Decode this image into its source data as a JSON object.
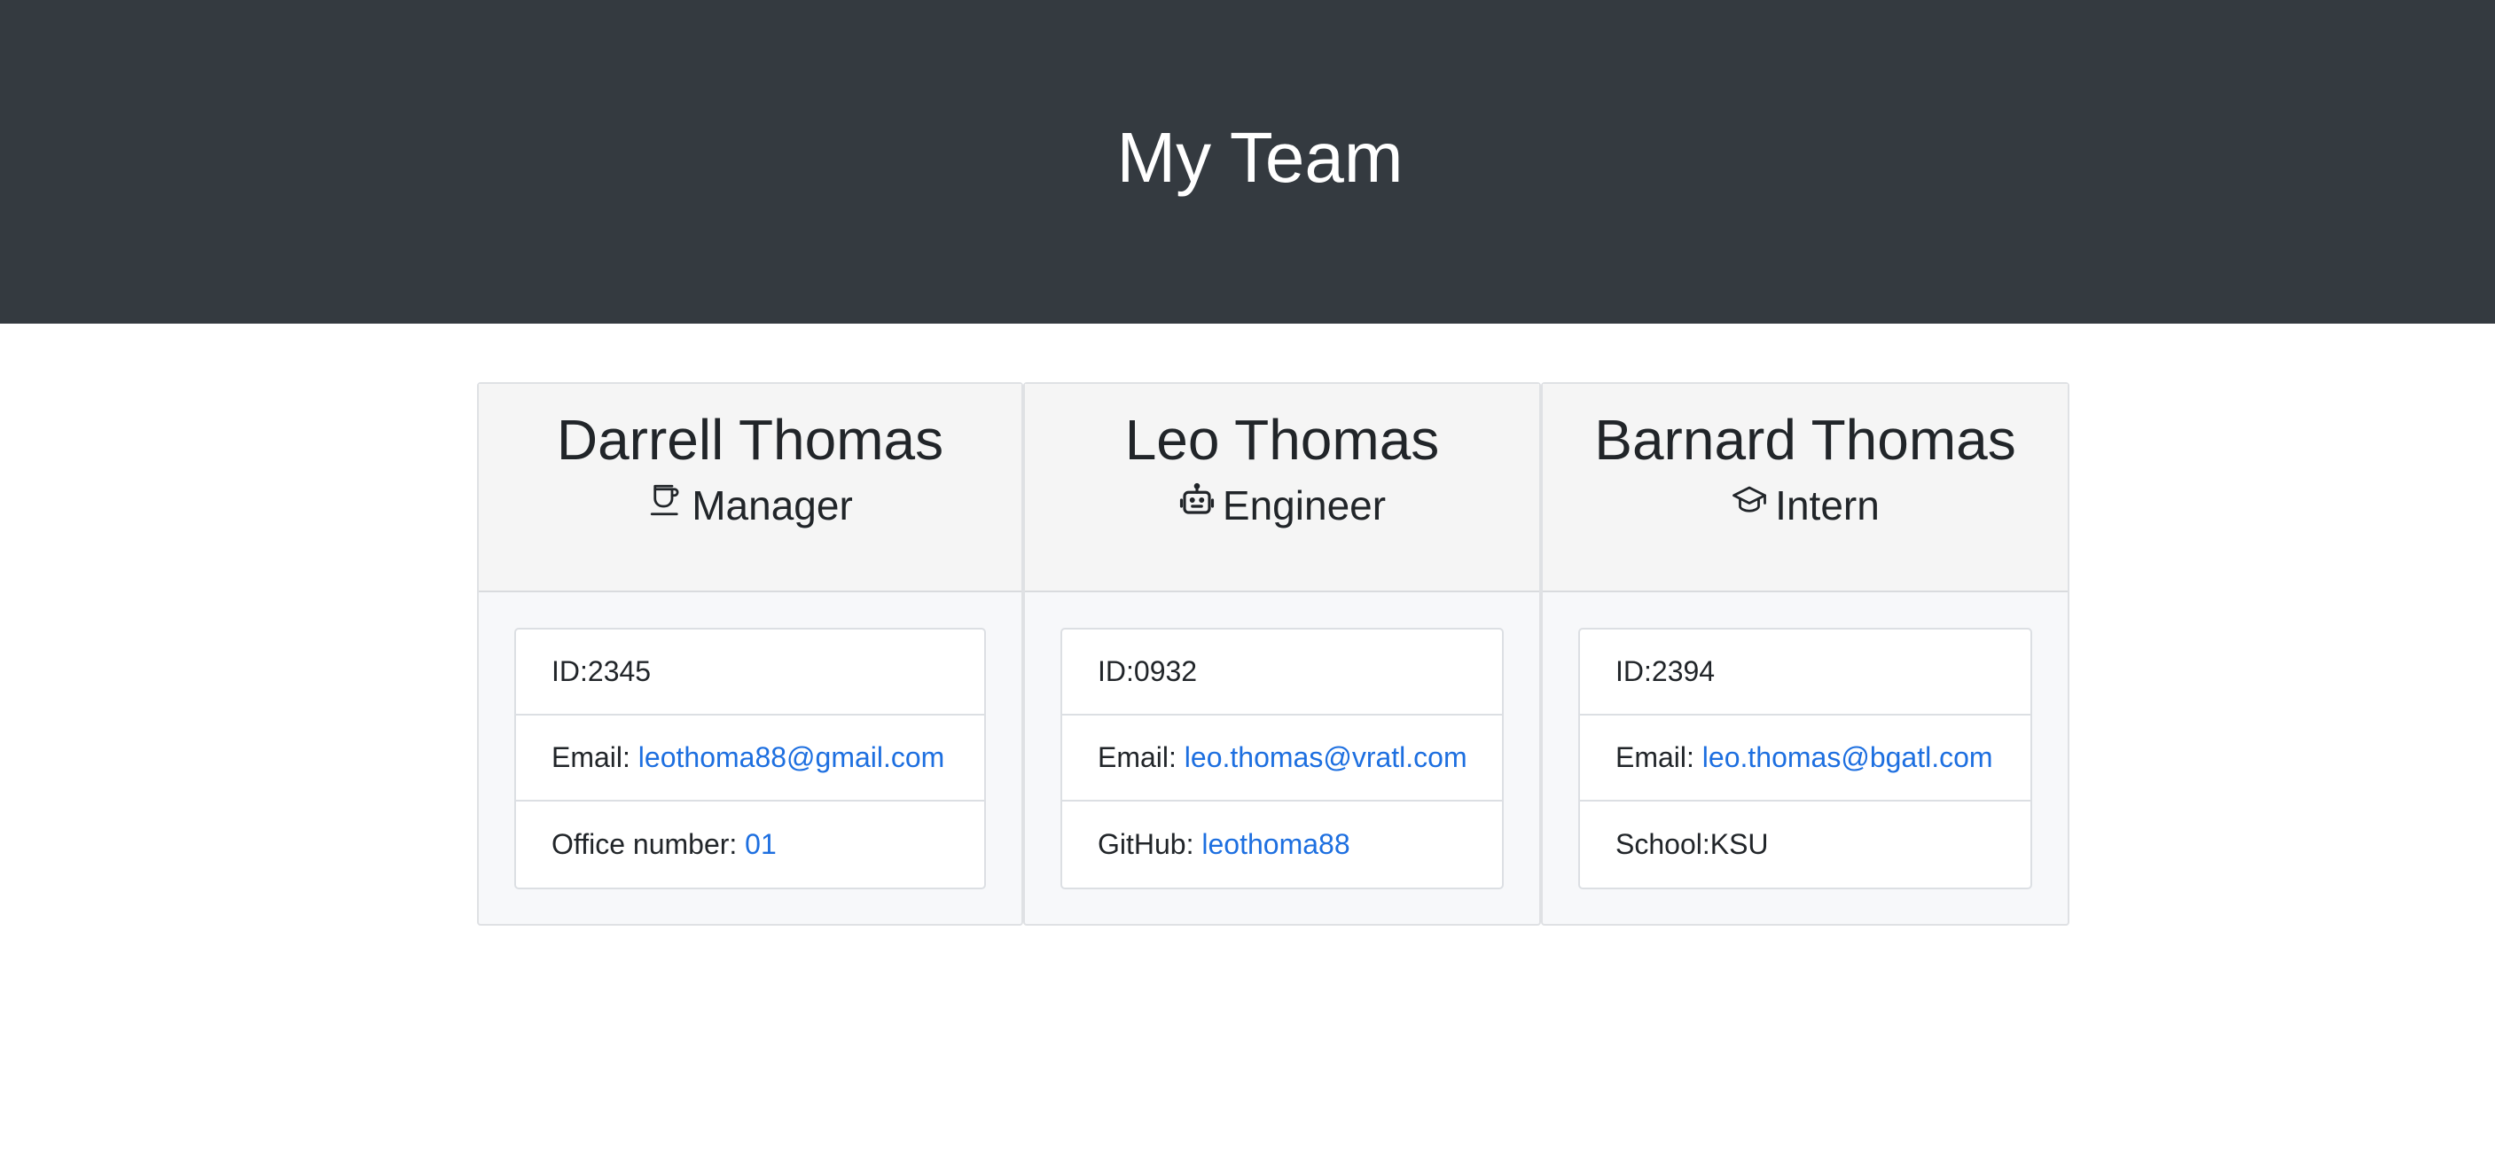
{
  "header": {
    "title": "My Team"
  },
  "colors": {
    "header_bg": "#343a40",
    "link": "#1d6fe0",
    "card_bg": "#f7f8fa"
  },
  "members": [
    {
      "name": "Darrell Thomas",
      "role": "Manager",
      "icon": "coffee-cup-icon",
      "id_text": "ID:2345",
      "email_label": "Email: ",
      "email": "leothoma88@gmail.com",
      "extra_label": "Office number: ",
      "extra_value": "01"
    },
    {
      "name": "Leo Thomas",
      "role": "Engineer",
      "icon": "robot-icon",
      "id_text": "ID:0932",
      "email_label": "Email: ",
      "email": "leo.thomas@vratl.com",
      "extra_label": "GitHub: ",
      "extra_value": "leothoma88"
    },
    {
      "name": "Barnard Thomas",
      "role": "Intern",
      "icon": "graduation-cap-icon",
      "id_text": "ID:2394",
      "email_label": "Email: ",
      "email": "leo.thomas@bgatl.com",
      "extra_label": "School:",
      "extra_value": "KSU"
    }
  ]
}
